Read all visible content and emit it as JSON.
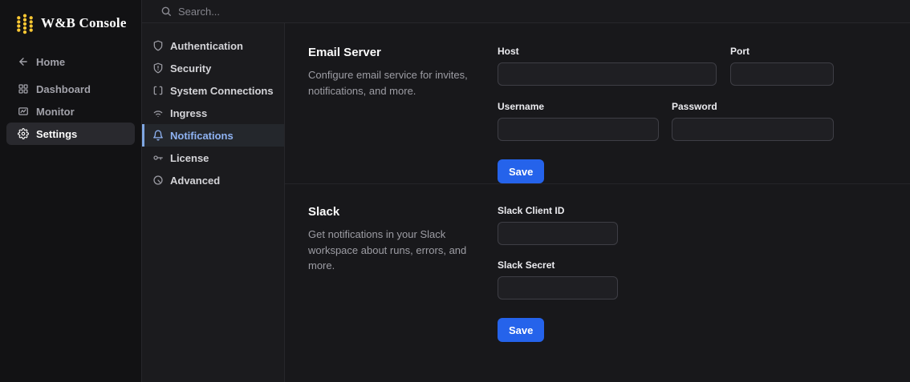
{
  "brand": {
    "title": "W&B Console"
  },
  "search": {
    "placeholder": "Search..."
  },
  "left_nav": {
    "items": [
      {
        "label": "Home",
        "icon": "arrow-left",
        "selected": false
      },
      {
        "label": "Dashboard",
        "icon": "dashboard-grid",
        "selected": false
      },
      {
        "label": "Monitor",
        "icon": "monitor-chart",
        "selected": false
      },
      {
        "label": "Settings",
        "icon": "gear",
        "selected": true
      }
    ]
  },
  "settings_nav": {
    "items": [
      {
        "label": "Authentication",
        "icon": "shield",
        "selected": false
      },
      {
        "label": "Security",
        "icon": "shield-alert",
        "selected": false
      },
      {
        "label": "System Connections",
        "icon": "brackets",
        "selected": false
      },
      {
        "label": "Ingress",
        "icon": "wifi",
        "selected": false
      },
      {
        "label": "Notifications",
        "icon": "bell",
        "selected": true
      },
      {
        "label": "License",
        "icon": "key",
        "selected": false
      },
      {
        "label": "Advanced",
        "icon": "gauge",
        "selected": false
      }
    ]
  },
  "sections": [
    {
      "title": "Email Server",
      "description": "Configure email service for invites, notifications, and more.",
      "fields": [
        {
          "label": "Host",
          "value": ""
        },
        {
          "label": "Port",
          "value": ""
        },
        {
          "label": "Username",
          "value": ""
        },
        {
          "label": "Password",
          "value": ""
        }
      ],
      "save_label": "Save"
    },
    {
      "title": "Slack",
      "description": "Get notifications in your Slack workspace about runs, errors, and more.",
      "fields": [
        {
          "label": "Slack Client ID",
          "value": ""
        },
        {
          "label": "Slack Secret",
          "value": ""
        }
      ],
      "save_label": "Save"
    }
  ],
  "colors": {
    "accent_blue": "#2563EB",
    "selected_nav_blue": "#8FB3F3",
    "logo_gold": "#FFC933"
  }
}
